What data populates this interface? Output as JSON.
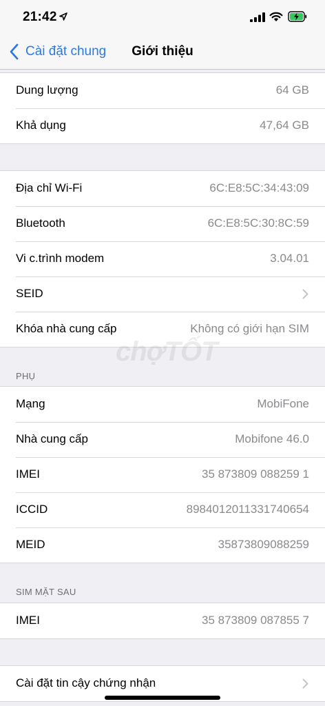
{
  "status_bar": {
    "time": "21:42"
  },
  "nav": {
    "back_label": "Cài đặt chung",
    "title": "Giới thiệu"
  },
  "group1": [
    {
      "label": "Dung lượng",
      "value": "64 GB"
    },
    {
      "label": "Khả dụng",
      "value": "47,64 GB"
    }
  ],
  "group2": [
    {
      "label": "Địa chỉ Wi-Fi",
      "value": "6C:E8:5C:34:43:09"
    },
    {
      "label": "Bluetooth",
      "value": "6C:E8:5C:30:8C:59"
    },
    {
      "label": "Vi c.trình modem",
      "value": "3.04.01"
    },
    {
      "label": "SEID",
      "value": ""
    },
    {
      "label": "Khóa nhà cung cấp",
      "value": "Không có giới hạn SIM"
    }
  ],
  "section_phu": "PHỤ",
  "group3": [
    {
      "label": "Mạng",
      "value": "MobiFone"
    },
    {
      "label": "Nhà cung cấp",
      "value": "Mobifone 46.0"
    },
    {
      "label": "IMEI",
      "value": "35 873809 088259 1"
    },
    {
      "label": "ICCID",
      "value": "8984012011331740654"
    },
    {
      "label": "MEID",
      "value": "35873809088259"
    }
  ],
  "section_sim": "SIM MẶT SAU",
  "group4": [
    {
      "label": "IMEI",
      "value": "35 873809 087855 7"
    }
  ],
  "group5": [
    {
      "label": "Cài đặt tin cậy chứng nhận",
      "value": ""
    }
  ],
  "watermark": "chợTỐT",
  "colors": {
    "accent": "#2a7ae2",
    "battery_charge": "#34c759"
  }
}
